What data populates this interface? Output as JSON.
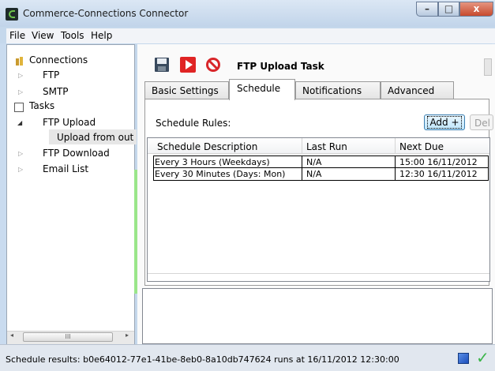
{
  "window": {
    "title": "Commerce-Connections Connector",
    "controls": {
      "minimize": "–",
      "maximize": "□",
      "close": "x"
    }
  },
  "menu": [
    "File",
    "View",
    "Tools",
    "Help"
  ],
  "tree": {
    "connections": "Connections",
    "ftp": "FTP",
    "smtp": "SMTP",
    "tasks": "Tasks",
    "ftp_upload": "FTP Upload",
    "upload_from_out": "Upload from out",
    "ftp_download": "FTP Download",
    "email_list": "Email List",
    "scroll_left": "◂",
    "scroll_thumb": "III",
    "scroll_right": "▸"
  },
  "toolbar": {
    "task_title": "FTP Upload Task",
    "icons": [
      "save-icon",
      "run-icon",
      "stop-icon"
    ]
  },
  "tabs": [
    "Basic Settings",
    "Schedule",
    "Notifications",
    "Advanced"
  ],
  "schedule": {
    "rules_label": "Schedule Rules:",
    "add_label": "Add +",
    "delete_label": "Del",
    "columns": [
      "Schedule Description",
      "Last Run",
      "Next Due"
    ],
    "rows": [
      {
        "description": "Every 3 Hours (Weekdays)",
        "last_run": "N/A",
        "next_due": "15:00 16/11/2012"
      },
      {
        "description": "Every 30 Minutes (Days: Mon)",
        "last_run": "N/A",
        "next_due": "12:30 16/11/2012"
      }
    ]
  },
  "status": {
    "text": "Schedule results: b0e64012-77e1-41be-8eb0-8a10db747624 runs at 16/11/2012 12:30:00",
    "check": "✓"
  },
  "colors": {
    "run": "#e02424",
    "stop": "#d8262a",
    "accent": "#3c7fb1",
    "ok": "#3bb54a"
  }
}
